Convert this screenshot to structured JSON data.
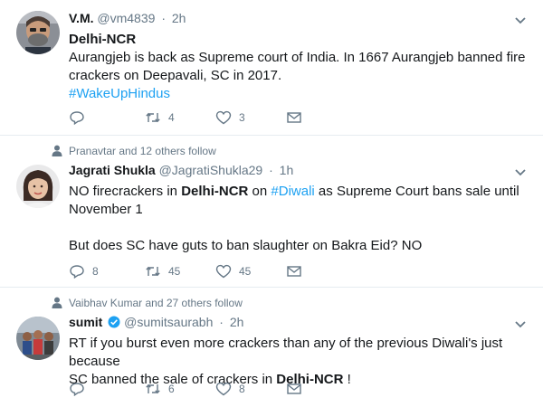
{
  "tweets": [
    {
      "name": "V.M.",
      "handle": "@vm4839",
      "separator": "·",
      "time": "2h",
      "title": "Delhi-NCR",
      "line1": "Aurangjeb is back as Supreme court of India. In 1667 Aurangjeb banned fire",
      "line2": "crackers on Deepavali, SC in 2017.",
      "hashtag": "#WakeUpHindus",
      "replies": "",
      "retweets": "4",
      "likes": "3"
    },
    {
      "social_context": "Pranavtar and 12 others follow",
      "name": "Jagrati Shukla",
      "handle": "@JagratiShukla29",
      "separator": "·",
      "time": "1h",
      "p1_a": "NO firecrackers in ",
      "p1_b": "Delhi-NCR",
      "p1_c": " on ",
      "p1_d": "#Diwali",
      "p1_e": " as Supreme Court bans sale until",
      "p1_line2": "November 1",
      "p2": "But does SC have guts to ban slaughter on Bakra Eid? NO",
      "replies": "8",
      "retweets": "45",
      "likes": "45"
    },
    {
      "social_context": "Vaibhav Kumar and 27 others follow",
      "name": "sumit",
      "handle": "@sumitsaurabh",
      "separator": "·",
      "time": "2h",
      "line1": "RT if you burst even more crackers than any of the previous Diwali's just because",
      "line2_a": "SC banned the sale of crackers in ",
      "line2_b": "Delhi-NCR",
      "line2_c": " !",
      "replies": "",
      "retweets": "6",
      "likes": "8"
    }
  ],
  "icons": {
    "reply": "reply-icon",
    "retweet": "retweet-icon",
    "like": "heart-icon",
    "dm": "envelope-icon",
    "more": "chevron-down-icon",
    "follow": "person-icon",
    "verified": "verified-badge-icon"
  },
  "colors": {
    "link": "#1da1f2",
    "muted": "#657786",
    "divider": "#e6ecf0",
    "verified": "#1da1f2"
  }
}
